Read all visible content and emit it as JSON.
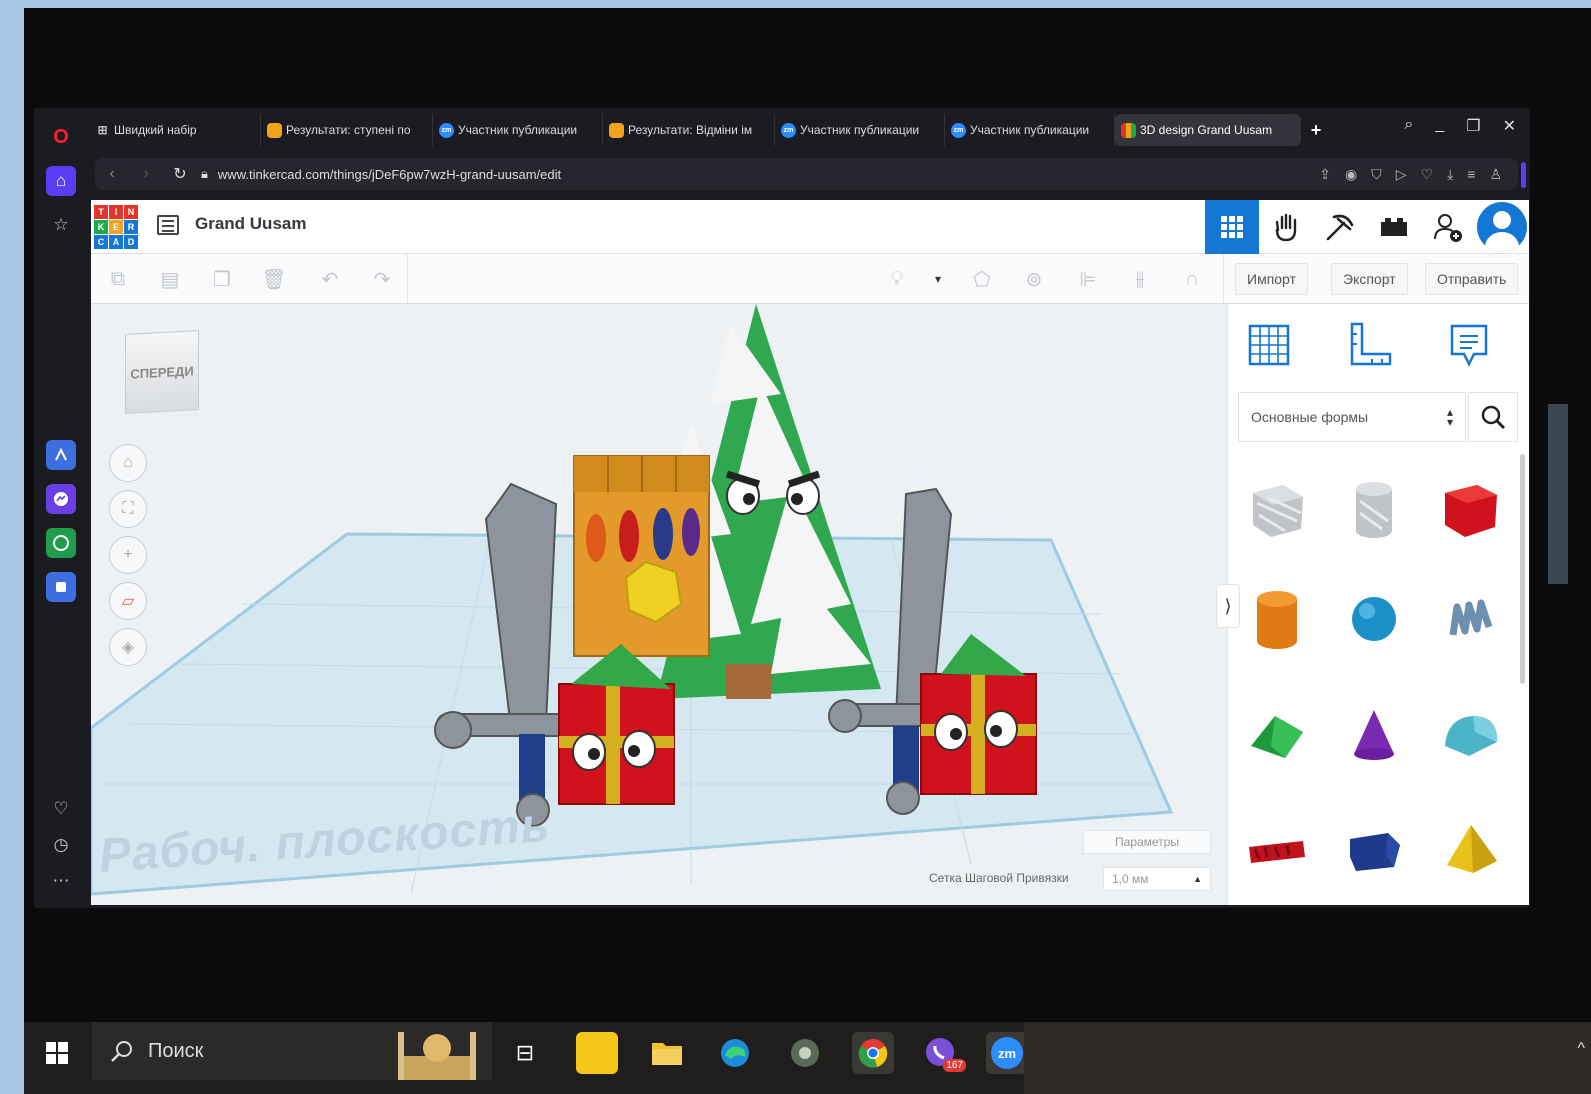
{
  "browser": {
    "tabs": [
      {
        "label": "Швидкий набір",
        "favicon": "grid"
      },
      {
        "label": "Результати: ступені по",
        "favicon": "form"
      },
      {
        "label": "Участник публикации",
        "favicon": "zoom"
      },
      {
        "label": "Результати: Відміни ім",
        "favicon": "form"
      },
      {
        "label": "Участник публикации",
        "favicon": "zoom"
      },
      {
        "label": "Участник публикации",
        "favicon": "zoom"
      },
      {
        "label": "3D design Grand Uusam",
        "favicon": "tinkercad"
      }
    ],
    "new_tab": "+",
    "url": "www.tinkercad.com/things/jDeF6pw7wzH-grand-uusam/edit"
  },
  "app": {
    "logo_letters": [
      "T",
      "I",
      "N",
      "K",
      "E",
      "R",
      "C",
      "A",
      "D"
    ],
    "design_title": "Grand Uusam",
    "toolbar": {
      "import_label": "Импорт",
      "export_label": "Экспорт",
      "send_label": "Отправить"
    },
    "viewcube_label": "СПЕРЕДИ",
    "workplane_label": "Рабоч. плоскость",
    "params_label": "Параметры",
    "snap_grid_label": "Сетка Шаговой Привязки",
    "snap_grid_value": "1,0 мм",
    "shape_category": "Основные формы"
  },
  "taskbar": {
    "search_label": "Поиск",
    "viber_badge": "167",
    "zoom_label": "zm"
  },
  "colors": {
    "accent": "#1477d5",
    "tinkercad_red": "#e4352a",
    "tinkercad_orange": "#f2a31e",
    "tinkercad_green": "#1daa4c",
    "tinkercad_blue": "#1477d5"
  }
}
